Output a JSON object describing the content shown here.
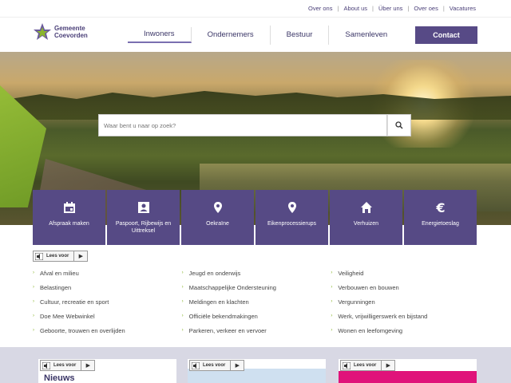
{
  "topbar": {
    "links": [
      "Over ons",
      "About us",
      "Über uns",
      "Over oes",
      "Vacatures"
    ]
  },
  "logo": {
    "line1": "Gemeente",
    "line2": "Coevorden"
  },
  "nav": {
    "items": [
      "Inwoners",
      "Ondernemers",
      "Bestuur",
      "Samenleven"
    ],
    "active": "Inwoners",
    "contact": "Contact"
  },
  "search": {
    "placeholder": "Waar bent u naar op zoek?"
  },
  "tiles": [
    {
      "label": "Afspraak maken",
      "icon": "calendar-icon"
    },
    {
      "label": "Paspoort, Rijbewijs en Uittreksel",
      "icon": "id-card-icon"
    },
    {
      "label": "Oekraïne",
      "icon": "location-pin-icon"
    },
    {
      "label": "Eikenprocessierups",
      "icon": "location-pin-icon"
    },
    {
      "label": "Verhuizen",
      "icon": "home-icon"
    },
    {
      "label": "Energietoeslag",
      "icon": "euro-icon"
    }
  ],
  "leesvoor": "Lees voor",
  "links": {
    "col1": [
      "Afval en milieu",
      "Belastingen",
      "Cultuur, recreatie en sport",
      "Doe Mee Webwinkel",
      "Geboorte, trouwen en overlijden"
    ],
    "col2": [
      "Jeugd en onderwijs",
      "Maatschappelijke Ondersteuning",
      "Meldingen en klachten",
      "Officiële bekendmakingen",
      "Parkeren, verkeer en vervoer"
    ],
    "col3": [
      "Veiligheid",
      "Verbouwen en bouwen",
      "Vergunningen",
      "Werk, vrijwilligerswerk en bijstand",
      "Wonen en leefomgeving"
    ]
  },
  "cards": {
    "news_title": "Nieuws"
  },
  "colors": {
    "primary": "#564a85",
    "accent": "#8ab52e"
  }
}
